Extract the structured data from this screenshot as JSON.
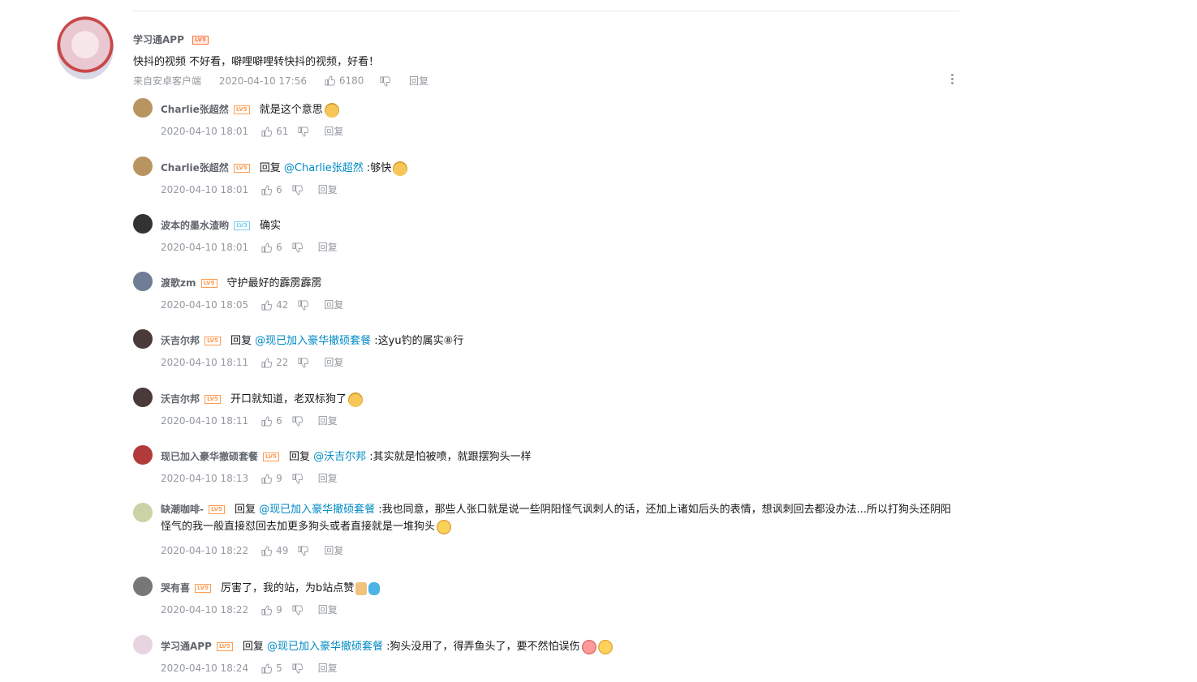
{
  "main_comment": {
    "user": "学习通APP",
    "level": "LV5",
    "text": "快抖的视频 不好看，噼哩噼哩转快抖的视频，好看！",
    "source": "来自安卓客户端",
    "time": "2020-04-10 17:56",
    "likes": "6180",
    "reply_label": "回复"
  },
  "replies": [
    {
      "user": "Charlie张超然",
      "level": "LV5",
      "prefix": "",
      "mention": "",
      "text": "就是这个意思",
      "emoji": "doge-emoji",
      "time": "2020-04-10 18:01",
      "likes": "61",
      "reply_label": "回复"
    },
    {
      "user": "Charlie张超然",
      "level": "LV5",
      "prefix": "回复 ",
      "mention": "@Charlie张超然",
      "text": " :够快",
      "emoji": "doge-emoji",
      "time": "2020-04-10 18:01",
      "likes": "6",
      "reply_label": "回复"
    },
    {
      "user": "波本的墨水渣哟",
      "level": "LV3",
      "prefix": "",
      "mention": "",
      "text": "确实",
      "emoji": "",
      "time": "2020-04-10 18:01",
      "likes": "6",
      "reply_label": "回复"
    },
    {
      "user": "渡歌zm",
      "level": "LV5",
      "prefix": "",
      "mention": "",
      "text": "守护最好的霹雳霹雳",
      "emoji": "",
      "time": "2020-04-10 18:05",
      "likes": "42",
      "reply_label": "回复"
    },
    {
      "user": "沃吉尔邦",
      "level": "LV5",
      "prefix": "回复 ",
      "mention": "@现已加入豪华撤硕套餐",
      "text": " :这yu钓的属实⑧行",
      "emoji": "",
      "time": "2020-04-10 18:11",
      "likes": "22",
      "reply_label": "回复"
    },
    {
      "user": "沃吉尔邦",
      "level": "LV5",
      "prefix": "",
      "mention": "",
      "text": "开口就知道，老双标狗了",
      "emoji": "doge-emoji",
      "time": "2020-04-10 18:11",
      "likes": "6",
      "reply_label": "回复"
    },
    {
      "user": "现已加入豪华撤硕套餐",
      "level": "LV5",
      "prefix": "回复 ",
      "mention": "@沃吉尔邦",
      "text": " :其实就是怕被喷，就跟摆狗头一样",
      "emoji": "",
      "time": "2020-04-10 18:13",
      "likes": "9",
      "reply_label": "回复"
    },
    {
      "user": "缺潮咖啡-",
      "level": "LV5",
      "prefix": "回复 ",
      "mention": "@现已加入豪华撤硕套餐",
      "text": " :我也同意，那些人张口就是说一些阴阳怪气讽刺人的话，还加上诸如后头的表情，想讽刺回去都没办法...所以打狗头还阴阳怪气的我一般直接怼回去加更多狗头或者直接就是一堆狗头",
      "emoji": "blush-emoji",
      "time": "2020-04-10 18:22",
      "likes": "49",
      "reply_label": "回复"
    },
    {
      "user": "哭有喜",
      "level": "LV5",
      "prefix": "",
      "mention": "",
      "text": "厉害了，我的站，为b站点赞",
      "emoji": "thumbs-fish-emoji",
      "time": "2020-04-10 18:22",
      "likes": "9",
      "reply_label": "回复"
    },
    {
      "user": "学习通APP",
      "level": "LV5",
      "prefix": "回复 ",
      "mention": "@现已加入豪华撤硕套餐",
      "text": " :狗头没用了，得弄鱼头了，要不然怕误伤",
      "emoji": "love-shy-emoji",
      "time": "2020-04-10 18:24",
      "likes": "5",
      "reply_label": "回复"
    }
  ],
  "colors": {
    "mention": "#008ac5",
    "meta": "#9499a0",
    "username": "#61666d"
  }
}
